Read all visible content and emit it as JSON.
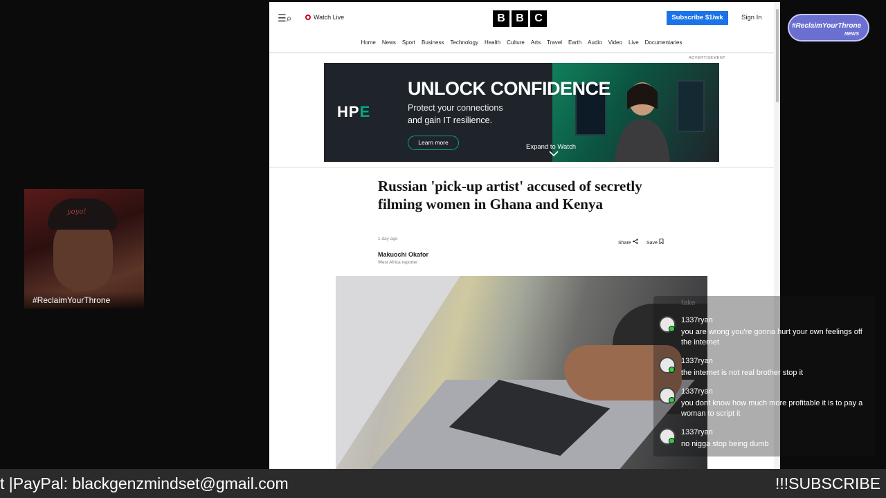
{
  "browser": {
    "menu_icon": "☰",
    "search_icon": "⌕",
    "watch_live": "Watch Live",
    "logo_letters": [
      "B",
      "B",
      "C"
    ],
    "subscribe": "Subscribe $1/wk",
    "sign_in": "Sign In",
    "nav": [
      "Home",
      "News",
      "Sport",
      "Business",
      "Technology",
      "Health",
      "Culture",
      "Arts",
      "Travel",
      "Earth",
      "Audio",
      "Video",
      "Live",
      "Documentaries"
    ]
  },
  "ad": {
    "label": "ADVERTISEMENT",
    "brand_main": "HP",
    "brand_accent": "E",
    "headline": "UNLOCK CONFIDENCE",
    "line1": "Protect your connections",
    "line2": "and gain IT resilience.",
    "cta": "Learn more",
    "expand": "Expand to Watch"
  },
  "article": {
    "headline": "Russian 'pick-up artist' accused of secretly filming women in Ghana and Kenya",
    "date": "1 day ago",
    "share": "Share",
    "save": "Save",
    "author": "Makuochi Okafor",
    "author_role": "West Africa reporter"
  },
  "webcam": {
    "tag": "#ReclaimYourThrone",
    "hat_text": "yoyo!"
  },
  "news_logo": {
    "text": "#ReclaimYourThrone",
    "sub": "NEWS"
  },
  "chat": {
    "faded": "fake",
    "messages": [
      {
        "user": "1337ryan",
        "text": "you are wrong you're gonna hurt your own feelings off the internet"
      },
      {
        "user": "1337ryan",
        "text": "the internet is not real brother stop it"
      },
      {
        "user": "1337ryan",
        "text": "you dont know how much more profitable it is to pay a woman to script it"
      },
      {
        "user": "1337ryan",
        "text": "no nigga stop being dumb"
      }
    ]
  },
  "ticker": {
    "left": "t |PayPal: blackgenzmindset@gmail.com",
    "right": "!!!SUBSCRIBE"
  }
}
